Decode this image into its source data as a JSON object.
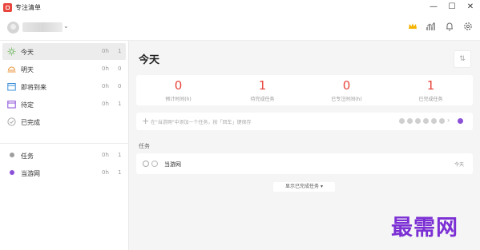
{
  "app": {
    "title": "专注清单"
  },
  "window_controls": {
    "minimize": "—",
    "maximize": "☐",
    "close": "✕"
  },
  "user": {
    "name": ""
  },
  "sidebar": {
    "items": [
      {
        "label": "今天",
        "hours": "0h",
        "count": "1",
        "icon": "sun-icon",
        "active": true
      },
      {
        "label": "明天",
        "hours": "0h",
        "count": "0",
        "icon": "sunset-icon"
      },
      {
        "label": "即将到来",
        "hours": "0h",
        "count": "0",
        "icon": "calendar-icon"
      },
      {
        "label": "待定",
        "hours": "0h",
        "count": "1",
        "icon": "inbox-icon"
      },
      {
        "label": "已完成",
        "hours": "",
        "count": "",
        "icon": "check-circle-icon"
      }
    ],
    "projects": [
      {
        "label": "任务",
        "hours": "0h",
        "count": "1",
        "color": "#9e9e9e"
      },
      {
        "label": "当游网",
        "hours": "0h",
        "count": "1",
        "color": "#8b4fd8"
      }
    ]
  },
  "main": {
    "title": "今天",
    "stats": [
      {
        "value": "0",
        "label": "预计时间(h)"
      },
      {
        "value": "1",
        "label": "待完成任务"
      },
      {
        "value": "0",
        "label": "已专注时间(h)"
      },
      {
        "value": "1",
        "label": "已完成任务"
      }
    ],
    "add_task_placeholder": "在\"当游网\"中添加一个任务，按「回车」键保存",
    "section_label": "任务",
    "tasks": [
      {
        "name": "当游网",
        "due": "今天"
      }
    ],
    "show_completed": "显示已完成任务 ▾"
  },
  "watermark": "最需网",
  "colors": {
    "accent": "#e8453c",
    "project": "#8b4fd8",
    "crown": "#f5b400"
  }
}
